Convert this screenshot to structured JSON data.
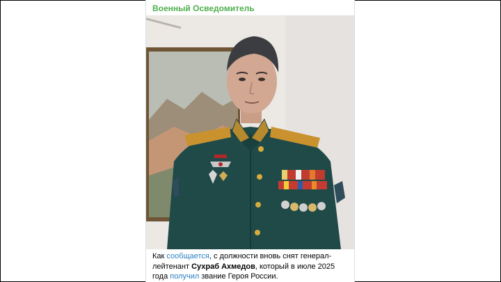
{
  "post": {
    "channel_name": "Военный Осведомитель",
    "caption": {
      "part1": "Как ",
      "link1": "сообщается",
      "part2": ", с должности вновь снят генерал-лейтенант ",
      "name_bold": "Сухраб Ахмедов",
      "part3": ", который в июле 2025 года ",
      "link2": "получил",
      "part4": " звание Героя России."
    }
  }
}
